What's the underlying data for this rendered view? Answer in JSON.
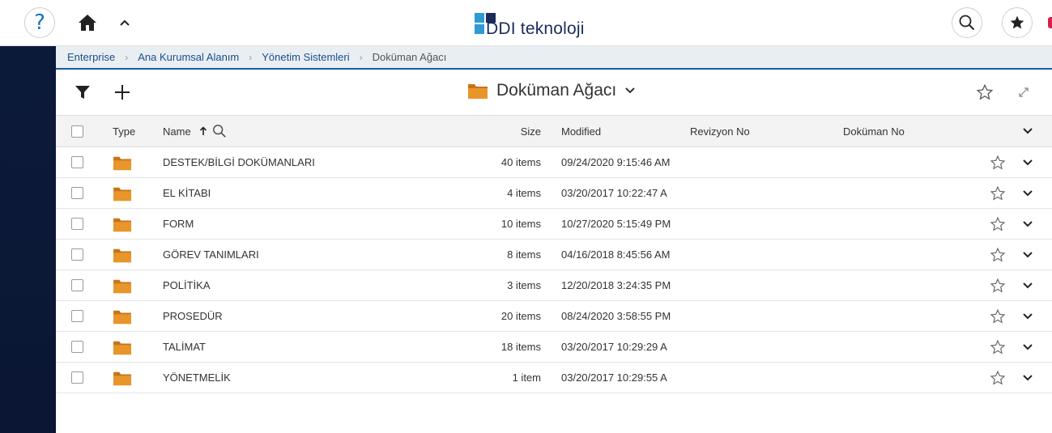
{
  "header": {
    "help_glyph": "?",
    "logo_text": "DDI teknoloji",
    "logo_colors": {
      "light": "#2e9ad6",
      "dark": "#1b2b5c"
    }
  },
  "breadcrumb": [
    {
      "label": "Enterprise"
    },
    {
      "label": "Ana Kurumsal Alanım"
    },
    {
      "label": "Yönetim Sistemleri"
    },
    {
      "label": "Doküman Ağacı"
    }
  ],
  "toolbar": {
    "folder_title": "Doküman Ağacı"
  },
  "table": {
    "columns": {
      "type": "Type",
      "name": "Name",
      "size": "Size",
      "modified": "Modified",
      "revizyon": "Revizyon No",
      "dokuman": "Doküman No"
    },
    "sort": {
      "column": "Name",
      "direction": "ascending"
    },
    "rows": [
      {
        "name": "DESTEK/BİLGİ DOKÜMANLARI",
        "size": "40 items",
        "modified": "09/24/2020 9:15:46 AM",
        "revizyon": "",
        "dokuman": ""
      },
      {
        "name": "EL KİTABI",
        "size": "4 items",
        "modified": "03/20/2017 10:22:47 A",
        "revizyon": "",
        "dokuman": ""
      },
      {
        "name": "FORM",
        "size": "10 items",
        "modified": "10/27/2020 5:15:49 PM",
        "revizyon": "",
        "dokuman": ""
      },
      {
        "name": "GÖREV TANIMLARI",
        "size": "8 items",
        "modified": "04/16/2018 8:45:56 AM",
        "revizyon": "",
        "dokuman": ""
      },
      {
        "name": "POLİTİKA",
        "size": "3 items",
        "modified": "12/20/2018 3:24:35 PM",
        "revizyon": "",
        "dokuman": ""
      },
      {
        "name": "PROSEDÜR",
        "size": "20 items",
        "modified": "08/24/2020 3:58:55 PM",
        "revizyon": "",
        "dokuman": ""
      },
      {
        "name": "TALİMAT",
        "size": "18 items",
        "modified": "03/20/2017 10:29:29 A",
        "revizyon": "",
        "dokuman": ""
      },
      {
        "name": "YÖNETMELİK",
        "size": "1 item",
        "modified": "03/20/2017 10:29:55 A",
        "revizyon": "",
        "dokuman": ""
      }
    ]
  },
  "colors": {
    "folder": "#e08a1e",
    "breadcrumb_bg": "#e9eef3",
    "breadcrumb_accent": "#1f5aa6",
    "leftrail": "#0c1a3a",
    "link": "#1b4f8a"
  },
  "icons": {
    "help": "question-mark-icon",
    "home": "home-icon",
    "collapse": "chevron-up-icon",
    "search": "search-icon",
    "favorites": "star-filled-icon",
    "filter": "filter-icon",
    "add": "plus-icon",
    "folder": "folder-icon",
    "expand": "expand-icon",
    "sort": "arrow-up-icon",
    "row_star": "star-outline-icon",
    "row_menu": "chevron-down-icon"
  }
}
